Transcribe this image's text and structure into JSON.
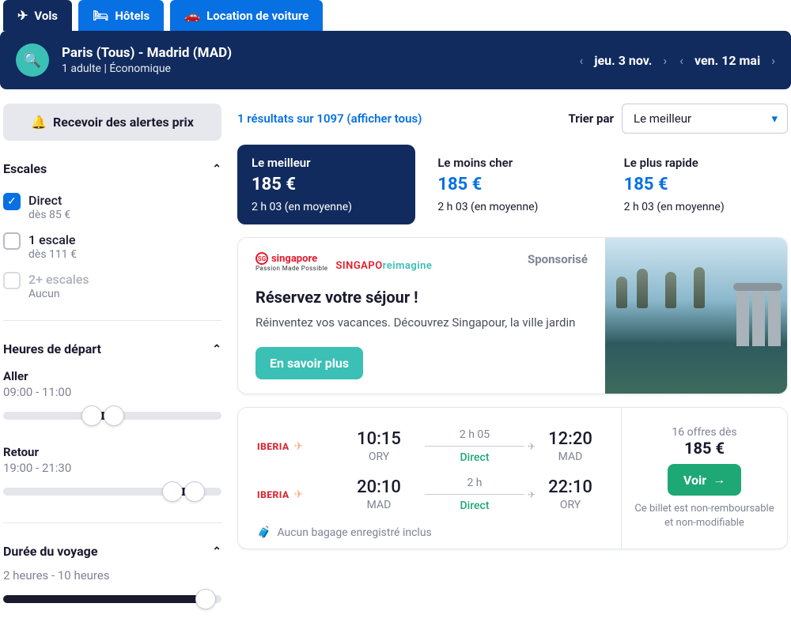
{
  "tabs": {
    "flights": "Vols",
    "hotels": "Hôtels",
    "car": "Location de voiture"
  },
  "search": {
    "route": "Paris (Tous) - Madrid (MAD)",
    "pax": "1 adulte | Économique",
    "depart": "jeu. 3 nov.",
    "return": "ven. 12 mai"
  },
  "sidebar": {
    "alert": "Recevoir des alertes prix",
    "stops_title": "Escales",
    "stops": [
      {
        "label": "Direct",
        "sub": "dès 85 €",
        "checked": true
      },
      {
        "label": "1 escale",
        "sub": "dès 111 €",
        "checked": false
      },
      {
        "label": "2+ escales",
        "sub": "Aucun",
        "checked": false,
        "disabled": true
      }
    ],
    "times_title": "Heures de départ",
    "aller_label": "Aller",
    "aller_range": "09:00 - 11:00",
    "retour_label": "Retour",
    "retour_range": "19:00 - 21:30",
    "duration_title": "Durée du voyage",
    "duration_range": "2 heures - 10 heures"
  },
  "results_header": {
    "count": "1 résultats sur 1097 (afficher tous)",
    "sort_label": "Trier par",
    "sort_value": "Le meilleur"
  },
  "compare": [
    {
      "title": "Le meilleur",
      "price": "185 €",
      "duration": "2 h 03 (en moyenne)"
    },
    {
      "title": "Le moins cher",
      "price": "185 €",
      "duration": "2 h 03 (en moyenne)"
    },
    {
      "title": "Le plus rapide",
      "price": "185 €",
      "duration": "2 h 03 (en moyenne)"
    }
  ],
  "sponsor": {
    "brand": "singapore",
    "brand_sub": "Passion Made Possible",
    "reimagine_1": "SINGAPO",
    "reimagine_2": "reimagine",
    "tag": "Sponsorisé",
    "title": "Réservez votre séjour  !",
    "body": "Réinventez vos vacances. Découvrez Singapour, la ville jardin",
    "cta": "En savoir plus"
  },
  "result": {
    "airline": "IBERIA",
    "out": {
      "dep_time": "10:15",
      "dep_code": "ORY",
      "dur": "2 h 05",
      "direct": "Direct",
      "arr_time": "12:20",
      "arr_code": "MAD"
    },
    "ret": {
      "dep_time": "20:10",
      "dep_code": "MAD",
      "dur": "2 h",
      "direct": "Direct",
      "arr_time": "22:10",
      "arr_code": "ORY"
    },
    "baggage": "Aucun bagage enregistré inclus",
    "offers": "16 offres dès",
    "price": "185 €",
    "cta": "Voir",
    "disclaimer": "Ce billet est non-remboursable et non-modifiable"
  }
}
